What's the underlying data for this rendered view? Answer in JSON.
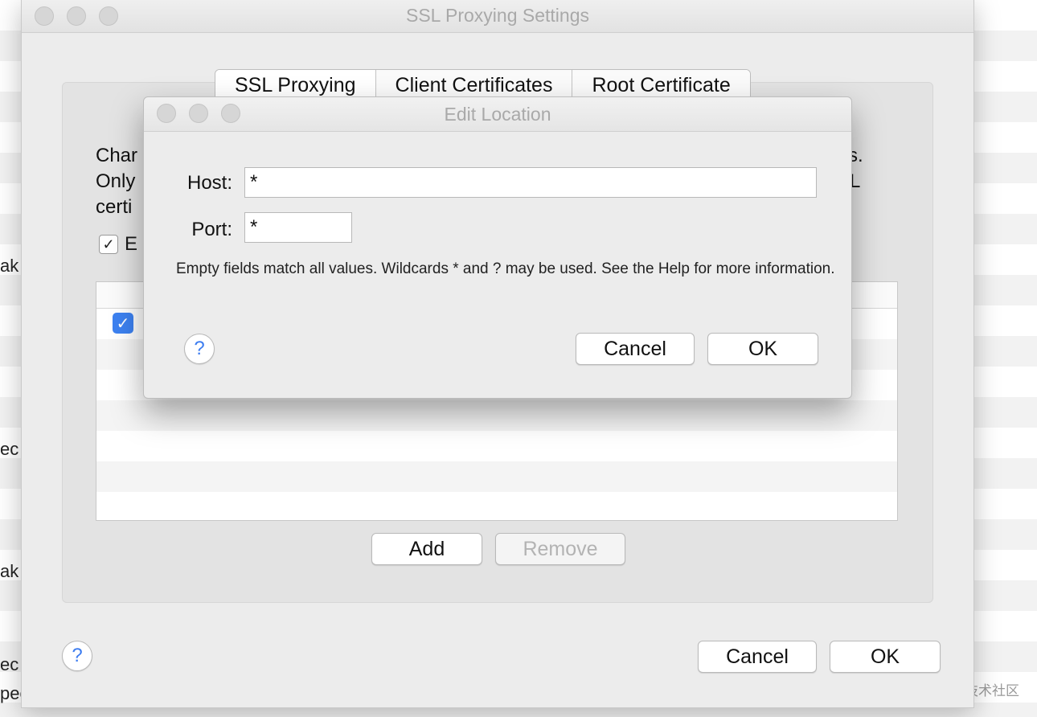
{
  "background": {
    "side_texts": [
      "ak",
      "ec",
      "ak",
      "ec",
      "pee"
    ],
    "watermark": "@稀土掘金技术社区"
  },
  "window": {
    "title": "SSL Proxying Settings",
    "tabs": [
      "SSL Proxying",
      "Client Certificates",
      "Root Certificate"
    ],
    "description_left": [
      "Char",
      "Only",
      "certi"
    ],
    "description_right": [
      "s.",
      "L"
    ],
    "enable_label_partial": "E",
    "add_label": "Add",
    "remove_label": "Remove",
    "cancel_label": "Cancel",
    "ok_label": "OK",
    "help_label": "?"
  },
  "dialog": {
    "title": "Edit Location",
    "host_label": "Host:",
    "host_value": "*",
    "port_label": "Port:",
    "port_value": "*",
    "info": "Empty fields match all values. Wildcards * and ? may be used. See the Help for more information.",
    "cancel_label": "Cancel",
    "ok_label": "OK",
    "help_label": "?"
  }
}
